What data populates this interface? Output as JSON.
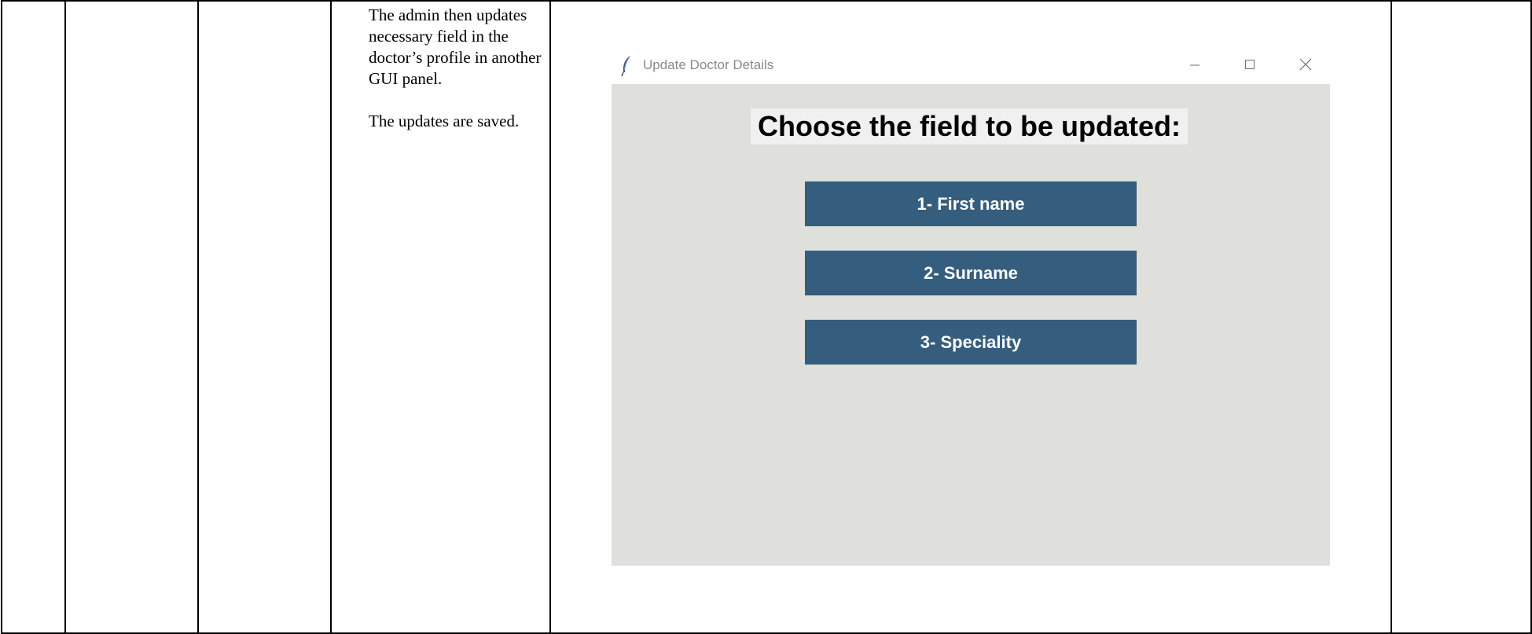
{
  "document": {
    "description_paragraphs": [
      "The admin then updates necessary field in the doctor’s profile in another GUI panel.",
      "The updates are saved."
    ]
  },
  "window": {
    "title": "Update Doctor Details",
    "icon": "feather-icon",
    "controls": {
      "minimize": "—",
      "maximize": "☐",
      "close": "✕"
    },
    "heading": "Choose the field to be updated:",
    "options": [
      "1- First name",
      "2- Surname",
      "3- Speciality"
    ],
    "colors": {
      "content_background": "#dfe0dc",
      "heading_background": "#f0f0f0",
      "button_background": "#355d7e",
      "button_text": "#ffffff"
    }
  }
}
